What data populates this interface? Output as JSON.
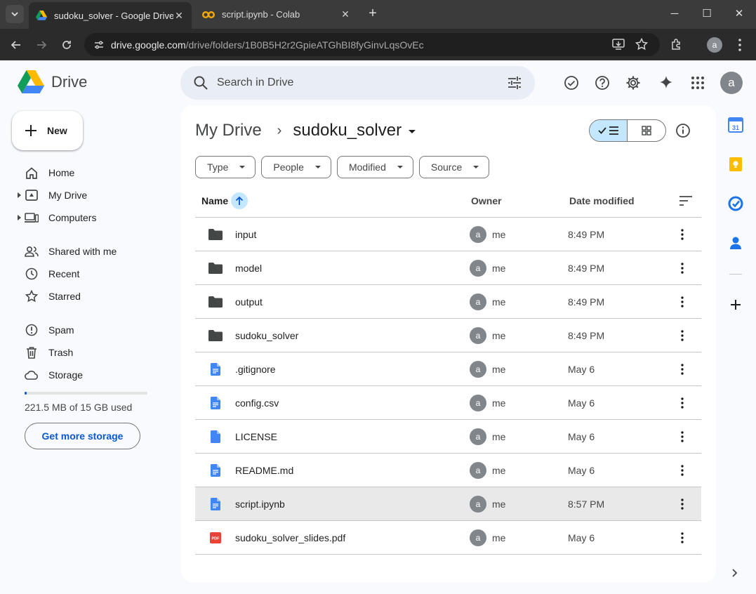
{
  "browser": {
    "tabs": [
      {
        "title": "sudoku_solver - Google Drive",
        "favicon": "google-drive-icon",
        "active": true
      },
      {
        "title": "script.ipynb - Colab",
        "favicon": "colab-icon",
        "active": false
      }
    ],
    "url_host": "drive.google.com",
    "url_path": "/drive/folders/1B0B5H2r2GpieATGhBI8fyGinvLqsOvEc",
    "profile_initial": "a"
  },
  "app": {
    "name": "Drive",
    "search_placeholder": "Search in Drive",
    "account_initial": "a"
  },
  "sidebar": {
    "new_label": "New",
    "items": [
      {
        "label": "Home",
        "icon": "home-icon"
      },
      {
        "label": "My Drive",
        "icon": "my-drive-icon",
        "expandable": true
      },
      {
        "label": "Computers",
        "icon": "computers-icon",
        "expandable": true
      },
      {
        "label": "Shared with me",
        "icon": "shared-icon"
      },
      {
        "label": "Recent",
        "icon": "clock-icon"
      },
      {
        "label": "Starred",
        "icon": "star-icon"
      },
      {
        "label": "Spam",
        "icon": "spam-icon"
      },
      {
        "label": "Trash",
        "icon": "trash-icon"
      },
      {
        "label": "Storage",
        "icon": "cloud-icon"
      }
    ],
    "storage_used_fraction": 0.0144,
    "storage_text": "221.5 MB of 15 GB used",
    "get_storage_label": "Get more storage"
  },
  "breadcrumb": {
    "root": "My Drive",
    "separator": "›",
    "current": "sudoku_solver"
  },
  "filters": [
    "Type",
    "People",
    "Modified",
    "Source"
  ],
  "table": {
    "headers": {
      "name": "Name",
      "owner": "Owner",
      "date": "Date modified"
    },
    "rows": [
      {
        "name": "input",
        "type": "folder",
        "owner_initial": "a",
        "owner": "me",
        "date": "8:49 PM"
      },
      {
        "name": "model",
        "type": "folder",
        "owner_initial": "a",
        "owner": "me",
        "date": "8:49 PM"
      },
      {
        "name": "output",
        "type": "folder",
        "owner_initial": "a",
        "owner": "me",
        "date": "8:49 PM"
      },
      {
        "name": "sudoku_solver",
        "type": "folder",
        "owner_initial": "a",
        "owner": "me",
        "date": "8:49 PM"
      },
      {
        "name": ".gitignore",
        "type": "doc",
        "owner_initial": "a",
        "owner": "me",
        "date": "May 6"
      },
      {
        "name": "config.csv",
        "type": "doc",
        "owner_initial": "a",
        "owner": "me",
        "date": "May 6"
      },
      {
        "name": "LICENSE",
        "type": "file",
        "owner_initial": "a",
        "owner": "me",
        "date": "May 6"
      },
      {
        "name": "README.md",
        "type": "doc",
        "owner_initial": "a",
        "owner": "me",
        "date": "May 6"
      },
      {
        "name": "script.ipynb",
        "type": "doc",
        "owner_initial": "a",
        "owner": "me",
        "date": "8:57 PM",
        "selected": true
      },
      {
        "name": "sudoku_solver_slides.pdf",
        "type": "pdf",
        "owner_initial": "a",
        "owner": "me",
        "date": "May 6"
      }
    ]
  },
  "side_panel": {
    "calendar_day": "31",
    "apps": [
      "calendar-icon",
      "keep-icon",
      "tasks-icon",
      "contacts-icon",
      "add-icon"
    ]
  },
  "colors": {
    "accent": "#0b57d0",
    "selected_chip": "#c2e7ff",
    "folder": "#444746",
    "doc": "#4285f4",
    "pdf": "#ea4335"
  }
}
